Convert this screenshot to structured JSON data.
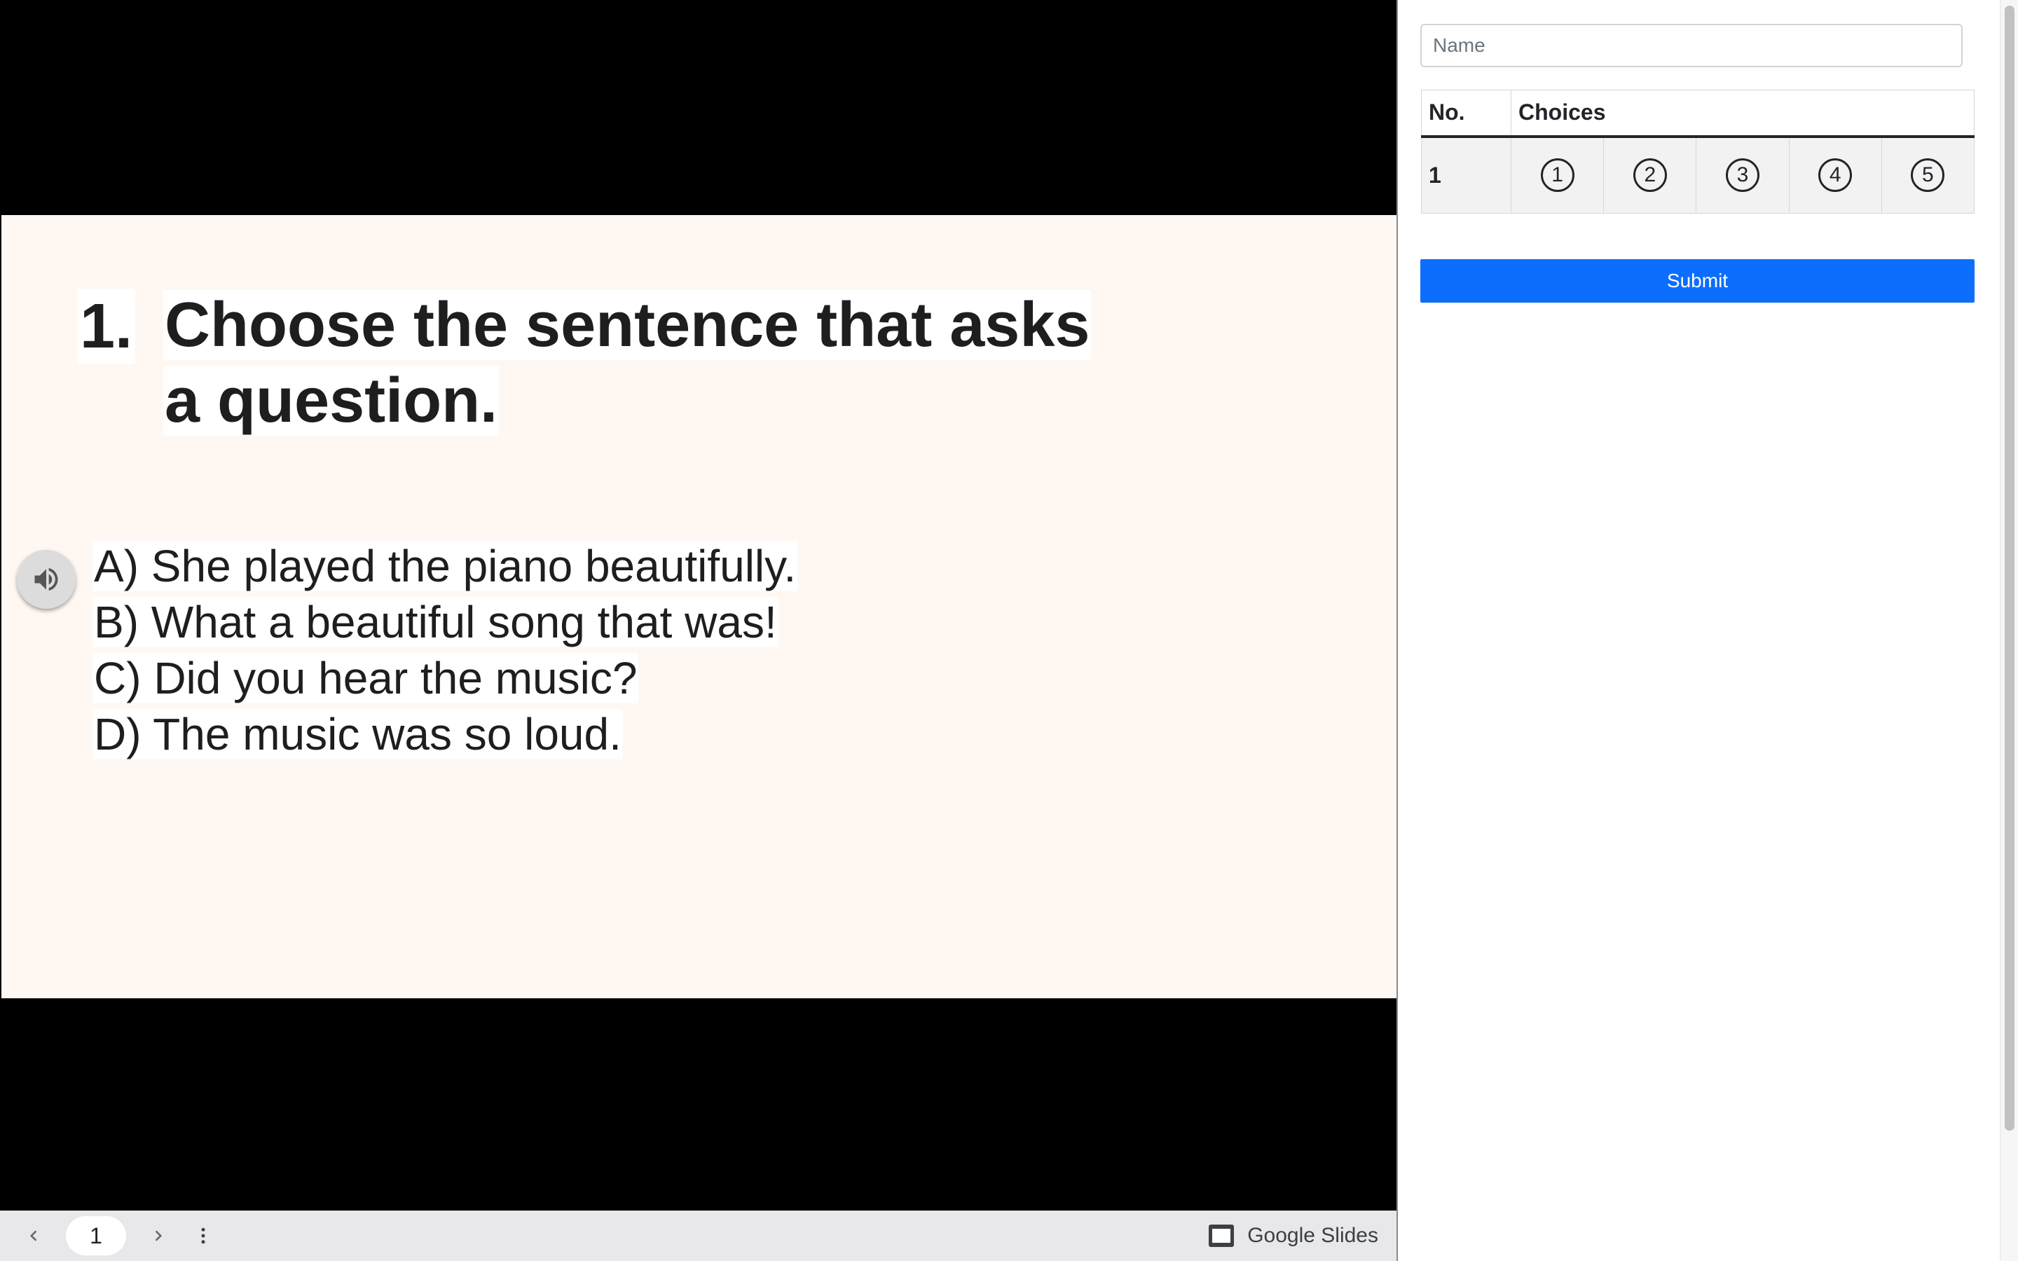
{
  "slide": {
    "question_number": "1.",
    "question_text": "Choose the sentence that asks a question.",
    "options": [
      "A) She played the piano beautifully.",
      "B) What a beautiful song that was!",
      "C) Did you hear the music?",
      "D) The music was so loud."
    ],
    "audio_icon": "speaker-icon",
    "background_color": "#fff7f2"
  },
  "slides_toolbar": {
    "prev_icon": "chevron-left-icon",
    "page": "1",
    "next_icon": "chevron-right-icon",
    "menu_icon": "more-vert-icon",
    "brand_icon": "google-slides-icon",
    "brand_label": "Google Slides"
  },
  "answer_sheet": {
    "name_placeholder": "Name",
    "name_value": "",
    "columns": [
      "No.",
      "Choices"
    ],
    "rows": [
      {
        "no": "1",
        "choices": [
          "1",
          "2",
          "3",
          "4",
          "5"
        ]
      }
    ],
    "submit_label": "Submit",
    "submit_color": "#0d6efd"
  }
}
